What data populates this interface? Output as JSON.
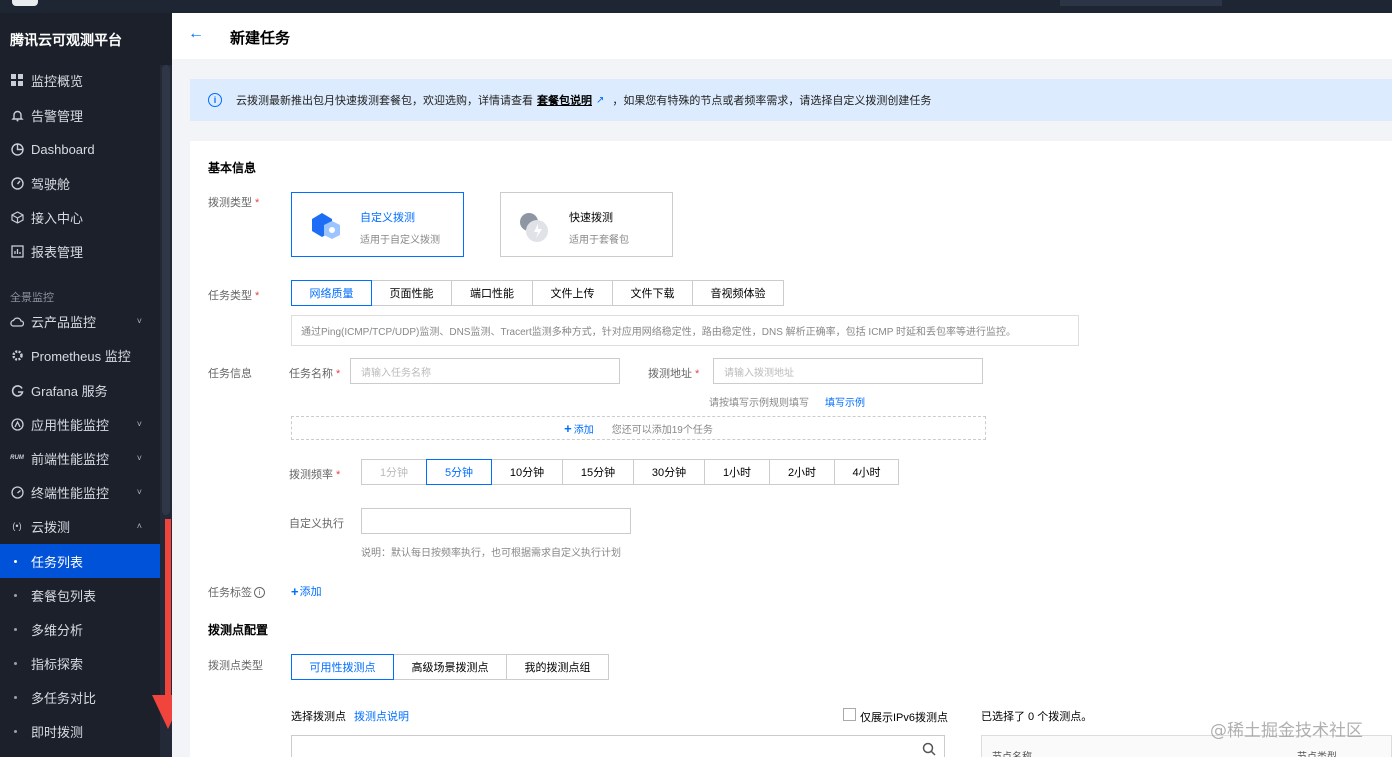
{
  "app": {
    "brand": "腾讯云可观测平台"
  },
  "sidebar": {
    "items": [
      {
        "label": "监控概览",
        "icon": "grid-icon"
      },
      {
        "label": "告警管理",
        "icon": "bell-icon"
      },
      {
        "label": "Dashboard",
        "icon": "dashboard-icon"
      },
      {
        "label": "驾驶舱",
        "icon": "gauge-icon"
      },
      {
        "label": "接入中心",
        "icon": "cube-icon"
      },
      {
        "label": "报表管理",
        "icon": "report-icon"
      }
    ],
    "section_label": "全景监控",
    "monitor_items": [
      {
        "label": "云产品监控",
        "icon": "cloud-icon",
        "expand": "˅"
      },
      {
        "label": "Prometheus 监控",
        "icon": "prometheus-icon",
        "expand": ""
      },
      {
        "label": "Grafana 服务",
        "icon": "grafana-icon",
        "expand": ""
      },
      {
        "label": "应用性能监控",
        "icon": "apm-icon",
        "expand": "˅"
      },
      {
        "label": "前端性能监控",
        "icon": "rum-icon",
        "expand": "˅"
      },
      {
        "label": "终端性能监控",
        "icon": "terminal-icon",
        "expand": "˅"
      },
      {
        "label": "云拨测",
        "icon": "probe-icon",
        "expand": "˄"
      }
    ],
    "sub_items": [
      "任务列表",
      "套餐包列表",
      "多维分析",
      "指标探索",
      "多任务对比",
      "即时拨测"
    ],
    "rum_badge": "RUM",
    "probe_glyph": "(•)"
  },
  "header": {
    "back_glyph": "←",
    "title": "新建任务"
  },
  "notice": {
    "info_glyph": "i",
    "text_before": "云拨测最新推出包月快速拨测套餐包，欢迎选购，详情请查看",
    "link": "套餐包说明",
    "ext_glyph": "↗",
    "text_after": "，如果您有特殊的节点或者频率需求，请选择自定义拨测创建任务"
  },
  "form": {
    "basic_title": "基本信息",
    "probe_type_label": "拨测类型",
    "required_mark": "*",
    "probe_types": [
      {
        "title": "自定义拨测",
        "desc": "适用于自定义拨测"
      },
      {
        "title": "快速拨测",
        "desc": "适用于套餐包"
      }
    ],
    "task_type_label": "任务类型",
    "task_types": [
      "网络质量",
      "页面性能",
      "端口性能",
      "文件上传",
      "文件下载",
      "音视频体验"
    ],
    "task_type_desc": "通过Ping(ICMP/TCP/UDP)监测、DNS监测、Tracert监测多种方式，针对应用网络稳定性，路由稳定性，DNS 解析正确率，包括 ICMP 时延和丢包率等进行监控。",
    "task_info_label": "任务信息",
    "task_name_label": "任务名称",
    "task_name_placeholder": "请输入任务名称",
    "probe_addr_label": "拨测地址",
    "probe_addr_placeholder": "请输入拨测地址",
    "addr_hint": "请按填写示例规则填写",
    "addr_example_link": "填写示例",
    "add_plus": "+",
    "add_label": "添加",
    "add_hint": "您还可以添加19个任务",
    "freq_label": "拨测频率",
    "frequencies": [
      "1分钟",
      "5分钟",
      "10分钟",
      "15分钟",
      "30分钟",
      "1小时",
      "2小时",
      "4小时"
    ],
    "custom_exec_label": "自定义执行",
    "custom_exec_hint": "说明：默认每日按频率执行，也可根据需求自定义执行计划",
    "tag_label": "任务标签",
    "tag_info_glyph": "i",
    "tag_add": "添加",
    "probe_config_title": "拨测点配置",
    "probe_point_type_label": "拨测点类型",
    "probe_point_types": [
      "可用性拨测点",
      "高级场景拨测点",
      "我的拨测点组"
    ],
    "select_points_label": "选择拨测点",
    "points_doc_link": "拨测点说明",
    "ipv6_only_label": "仅展示IPv6拨测点",
    "selected_count_text": "已选择了 0  个拨测点。",
    "table_headers": [
      "节点名称",
      "节点类型"
    ]
  },
  "watermark": "@稀土掘金技术社区",
  "colors": {
    "sidebar_bg": "#1b202b",
    "accent": "#0052d9",
    "link": "#006eff",
    "notice_bg": "#dcebfd",
    "arrow": "#f0443c"
  }
}
